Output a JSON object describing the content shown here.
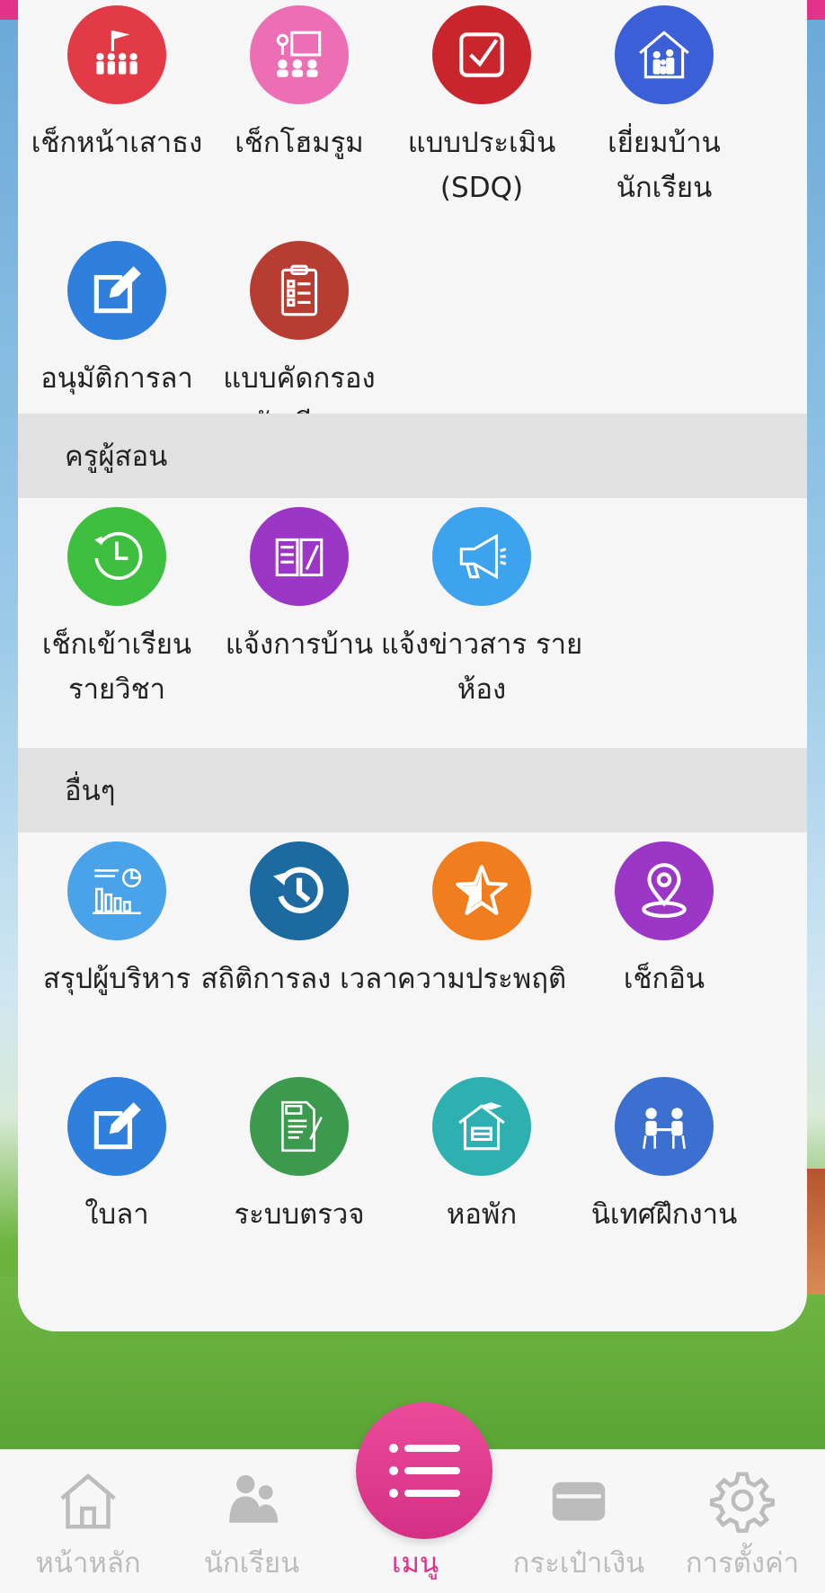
{
  "colors": {
    "accent": "#e2338a",
    "panel": "#f6f6f6",
    "section": "#e1e1e1"
  },
  "admin": {
    "items": [
      {
        "label": "เช็กหน้าเสาธง",
        "icon": "flag-ceremony-icon",
        "color": "#e23a47"
      },
      {
        "label": "เช็กโฮมรูม",
        "icon": "homeroom-icon",
        "color": "#ec6fb5"
      },
      {
        "label": "แบบประเมิน (SDQ)",
        "icon": "checkbox-icon",
        "color": "#c9252c"
      },
      {
        "label": "เยี่ยมบ้าน นักเรียน",
        "icon": "family-home-icon",
        "color": "#3b5fd6"
      },
      {
        "label": "อนุมัติการลา",
        "icon": "edit-icon",
        "color": "#2f7fdc"
      },
      {
        "label": "แบบคัดกรอง นักเรียน",
        "icon": "clipboard-icon",
        "color": "#b73d33"
      }
    ]
  },
  "teacher": {
    "title": "ครูผู้สอน",
    "items": [
      {
        "label": "เช็กเข้าเรียน รายวิชา",
        "icon": "clock-icon",
        "color": "#3fbf3f"
      },
      {
        "label": "แจ้งการบ้าน",
        "icon": "book-icon",
        "color": "#9b36c6"
      },
      {
        "label": "แจ้งข่าวสาร รายห้อง",
        "icon": "megaphone-icon",
        "color": "#3ea3ef"
      }
    ]
  },
  "other": {
    "title": "อื่นๆ",
    "items": [
      {
        "label": "สรุปผู้บริหาร",
        "icon": "report-chart-icon",
        "color": "#4aa2e8"
      },
      {
        "label": "สถิติการลง เวลา",
        "icon": "history-icon",
        "color": "#1c6aa0"
      },
      {
        "label": "ความประพฤติ",
        "icon": "star-icon",
        "color": "#f07e1e"
      },
      {
        "label": "เช็กอิน",
        "icon": "location-pin-icon",
        "color": "#9b36c6"
      },
      {
        "label": "ใบลา",
        "icon": "edit-icon",
        "color": "#2f7fdc"
      },
      {
        "label": "ระบบตรวจ",
        "icon": "exam-icon",
        "color": "#3c9a4f"
      },
      {
        "label": "หอพัก",
        "icon": "dormitory-icon",
        "color": "#2fb0b0"
      },
      {
        "label": "นิเทศฝึกงาน",
        "icon": "meeting-icon",
        "color": "#3b6fd0"
      }
    ]
  },
  "tabbar": {
    "tabs": [
      {
        "label": "หน้าหลัก",
        "icon": "home-icon"
      },
      {
        "label": "นักเรียน",
        "icon": "students-icon"
      },
      {
        "label": "เมนู",
        "icon": "menu-list-icon"
      },
      {
        "label": "กระเป๋าเงิน",
        "icon": "wallet-icon"
      },
      {
        "label": "การตั้งค่า",
        "icon": "gear-icon"
      }
    ]
  }
}
